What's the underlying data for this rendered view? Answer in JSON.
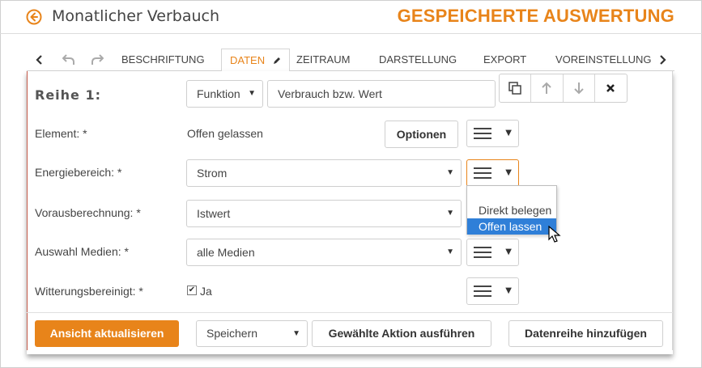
{
  "header": {
    "back_icon": "circle-arrow-left-icon",
    "title": "Monatlicher Verbauch",
    "brand_title": "GESPEICHERTE AUSWERTUNG",
    "accent_color": "#e8841a"
  },
  "tabbar": {
    "tabs": [
      {
        "label": "BESCHRIFTUNG"
      },
      {
        "label": "DATEN"
      },
      {
        "label": "ZEITRAUM"
      },
      {
        "label": "DARSTELLUNG"
      },
      {
        "label": "EXPORT"
      },
      {
        "label": "VOREINSTELLUNG"
      }
    ],
    "active_tab": "DATEN"
  },
  "series": {
    "label": "Reihe 1:",
    "function_select": "Funktion",
    "value_select": "Verbrauch bzw. Wert"
  },
  "rows": {
    "element": {
      "label": "Element:",
      "required": "*",
      "value": "Offen gelassen",
      "options_button": "Optionen"
    },
    "energy": {
      "label": "Energiebereich:",
      "required": "*",
      "value": "Strom"
    },
    "forecast": {
      "label": "Vorausberechnung:",
      "required": "*",
      "value": "Istwert"
    },
    "media": {
      "label": "Auswahl Medien:",
      "required": "*",
      "value": "alle Medien"
    },
    "weather": {
      "label": "Witterungsbereinigt:",
      "required": "*",
      "checkbox_label": "Ja",
      "checked": true
    }
  },
  "dropdown": {
    "items": [
      "Direkt belegen",
      "Offen lassen"
    ],
    "selected": "Offen lassen",
    "selected_color": "#2f7fd8"
  },
  "footer": {
    "update_button": "Ansicht aktualisieren",
    "action_select": "Speichern",
    "execute_button": "Gewählte Aktion ausführen",
    "add_series_button": "Datenreihe hinzufügen"
  }
}
